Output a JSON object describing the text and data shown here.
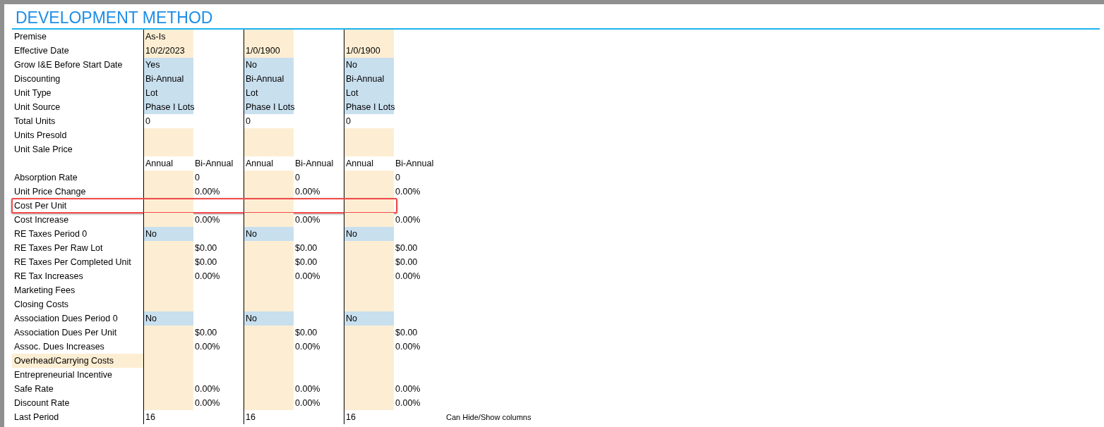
{
  "title": "DEVELOPMENT METHOD",
  "rows": [
    {
      "label": "Premise",
      "label_filled": false,
      "outlined": false,
      "cells": [
        {
          "kind": "input",
          "text": "As-Is"
        },
        {
          "kind": "plain"
        },
        {
          "kind": "input"
        },
        {
          "kind": "plain"
        },
        {
          "kind": "input"
        },
        {
          "kind": "plain"
        }
      ]
    },
    {
      "label": "Effective Date",
      "label_filled": false,
      "outlined": false,
      "cells": [
        {
          "kind": "input",
          "text": "10/2/2023"
        },
        {
          "kind": "plain"
        },
        {
          "kind": "input",
          "text": "1/0/1900"
        },
        {
          "kind": "plain"
        },
        {
          "kind": "input",
          "text": "1/0/1900"
        },
        {
          "kind": "plain"
        }
      ]
    },
    {
      "label": "Grow I&E Before Start Date",
      "label_filled": false,
      "outlined": false,
      "cells": [
        {
          "kind": "select",
          "text": "Yes"
        },
        {
          "kind": "plain"
        },
        {
          "kind": "select",
          "text": "No"
        },
        {
          "kind": "plain"
        },
        {
          "kind": "select",
          "text": "No"
        },
        {
          "kind": "plain"
        }
      ]
    },
    {
      "label": "Discounting",
      "label_filled": false,
      "outlined": false,
      "cells": [
        {
          "kind": "select",
          "text": "Bi-Annual"
        },
        {
          "kind": "plain"
        },
        {
          "kind": "select",
          "text": "Bi-Annual"
        },
        {
          "kind": "plain"
        },
        {
          "kind": "select",
          "text": "Bi-Annual"
        },
        {
          "kind": "plain"
        }
      ]
    },
    {
      "label": "Unit Type",
      "label_filled": false,
      "outlined": false,
      "cells": [
        {
          "kind": "select",
          "text": "Lot"
        },
        {
          "kind": "plain"
        },
        {
          "kind": "select",
          "text": "Lot"
        },
        {
          "kind": "plain"
        },
        {
          "kind": "select",
          "text": "Lot"
        },
        {
          "kind": "plain"
        }
      ]
    },
    {
      "label": "Unit Source",
      "label_filled": false,
      "outlined": false,
      "cells": [
        {
          "kind": "select",
          "text": "Phase I Lots"
        },
        {
          "kind": "plain"
        },
        {
          "kind": "select",
          "text": "Phase I Lots"
        },
        {
          "kind": "plain"
        },
        {
          "kind": "select",
          "text": "Phase I Lots"
        },
        {
          "kind": "plain"
        }
      ]
    },
    {
      "label": "Total Units",
      "label_filled": false,
      "outlined": false,
      "cells": [
        {
          "kind": "plain",
          "text": "0"
        },
        {
          "kind": "plain"
        },
        {
          "kind": "plain",
          "text": "0"
        },
        {
          "kind": "plain"
        },
        {
          "kind": "plain",
          "text": "0"
        },
        {
          "kind": "plain"
        }
      ]
    },
    {
      "label": "Units Presold",
      "label_filled": false,
      "outlined": false,
      "cells": [
        {
          "kind": "input"
        },
        {
          "kind": "plain"
        },
        {
          "kind": "input"
        },
        {
          "kind": "plain"
        },
        {
          "kind": "input"
        },
        {
          "kind": "plain"
        }
      ]
    },
    {
      "label": "Unit Sale Price",
      "label_filled": false,
      "outlined": false,
      "cells": [
        {
          "kind": "input"
        },
        {
          "kind": "plain"
        },
        {
          "kind": "input"
        },
        {
          "kind": "plain"
        },
        {
          "kind": "input"
        },
        {
          "kind": "plain"
        }
      ]
    },
    {
      "outlined": false,
      "cells": [
        {
          "kind": "plain",
          "text": "Annual"
        },
        {
          "kind": "plain",
          "text": "Bi-Annual"
        },
        {
          "kind": "plain",
          "text": "Annual"
        },
        {
          "kind": "plain",
          "text": "Bi-Annual"
        },
        {
          "kind": "plain",
          "text": "Annual"
        },
        {
          "kind": "plain",
          "text": "Bi-Annual"
        }
      ]
    },
    {
      "label": "Absorption Rate",
      "label_filled": false,
      "outlined": false,
      "cells": [
        {
          "kind": "input"
        },
        {
          "kind": "plain",
          "text": "0"
        },
        {
          "kind": "input"
        },
        {
          "kind": "plain",
          "text": "0"
        },
        {
          "kind": "input"
        },
        {
          "kind": "plain",
          "text": "0"
        }
      ]
    },
    {
      "label": "Unit Price Change",
      "label_filled": false,
      "outlined": false,
      "cells": [
        {
          "kind": "input"
        },
        {
          "kind": "plain",
          "text": "0.00%"
        },
        {
          "kind": "input"
        },
        {
          "kind": "plain",
          "text": "0.00%"
        },
        {
          "kind": "input"
        },
        {
          "kind": "plain",
          "text": "0.00%"
        }
      ]
    },
    {
      "label": "Cost Per Unit",
      "label_filled": false,
      "outlined": true,
      "cells": [
        {
          "kind": "input"
        },
        {
          "kind": "plain"
        },
        {
          "kind": "input"
        },
        {
          "kind": "plain"
        },
        {
          "kind": "input"
        },
        {
          "kind": "plain"
        }
      ]
    },
    {
      "label": "Cost Increase",
      "label_filled": false,
      "outlined": false,
      "cells": [
        {
          "kind": "input"
        },
        {
          "kind": "plain",
          "text": "0.00%"
        },
        {
          "kind": "input"
        },
        {
          "kind": "plain",
          "text": "0.00%"
        },
        {
          "kind": "input"
        },
        {
          "kind": "plain",
          "text": "0.00%"
        }
      ]
    },
    {
      "label": "RE Taxes Period 0",
      "label_filled": false,
      "outlined": false,
      "cells": [
        {
          "kind": "select",
          "text": "No"
        },
        {
          "kind": "plain"
        },
        {
          "kind": "select",
          "text": "No"
        },
        {
          "kind": "plain"
        },
        {
          "kind": "select",
          "text": "No"
        },
        {
          "kind": "plain"
        }
      ]
    },
    {
      "label": "RE Taxes Per Raw Lot",
      "label_filled": false,
      "outlined": false,
      "cells": [
        {
          "kind": "input"
        },
        {
          "kind": "plain",
          "text": "$0.00"
        },
        {
          "kind": "input"
        },
        {
          "kind": "plain",
          "text": "$0.00"
        },
        {
          "kind": "input"
        },
        {
          "kind": "plain",
          "text": "$0.00"
        }
      ]
    },
    {
      "label": "RE Taxes Per Completed Unit",
      "label_filled": false,
      "outlined": false,
      "cells": [
        {
          "kind": "input"
        },
        {
          "kind": "plain",
          "text": "$0.00"
        },
        {
          "kind": "input"
        },
        {
          "kind": "plain",
          "text": "$0.00"
        },
        {
          "kind": "input"
        },
        {
          "kind": "plain",
          "text": "$0.00"
        }
      ]
    },
    {
      "label": "RE Tax Increases",
      "label_filled": false,
      "outlined": false,
      "cells": [
        {
          "kind": "input"
        },
        {
          "kind": "plain",
          "text": "0.00%"
        },
        {
          "kind": "input"
        },
        {
          "kind": "plain",
          "text": "0.00%"
        },
        {
          "kind": "input"
        },
        {
          "kind": "plain",
          "text": "0.00%"
        }
      ]
    },
    {
      "label": "Marketing Fees",
      "label_filled": false,
      "outlined": false,
      "cells": [
        {
          "kind": "input"
        },
        {
          "kind": "plain"
        },
        {
          "kind": "input"
        },
        {
          "kind": "plain"
        },
        {
          "kind": "input"
        },
        {
          "kind": "plain"
        }
      ]
    },
    {
      "label": "Closing Costs",
      "label_filled": false,
      "outlined": false,
      "cells": [
        {
          "kind": "input"
        },
        {
          "kind": "plain"
        },
        {
          "kind": "input"
        },
        {
          "kind": "plain"
        },
        {
          "kind": "input"
        },
        {
          "kind": "plain"
        }
      ]
    },
    {
      "label": "Association Dues Period 0",
      "label_filled": false,
      "outlined": false,
      "cells": [
        {
          "kind": "select",
          "text": "No"
        },
        {
          "kind": "plain"
        },
        {
          "kind": "select",
          "text": "No"
        },
        {
          "kind": "plain"
        },
        {
          "kind": "select",
          "text": "No"
        },
        {
          "kind": "plain"
        }
      ]
    },
    {
      "label": "Association Dues Per Unit",
      "label_filled": false,
      "outlined": false,
      "cells": [
        {
          "kind": "input"
        },
        {
          "kind": "plain",
          "text": "$0.00"
        },
        {
          "kind": "input"
        },
        {
          "kind": "plain",
          "text": "$0.00"
        },
        {
          "kind": "input"
        },
        {
          "kind": "plain",
          "text": "$0.00"
        }
      ]
    },
    {
      "label": "Assoc. Dues Increases",
      "label_filled": false,
      "outlined": false,
      "cells": [
        {
          "kind": "input"
        },
        {
          "kind": "plain",
          "text": "0.00%"
        },
        {
          "kind": "input"
        },
        {
          "kind": "plain",
          "text": "0.00%"
        },
        {
          "kind": "input"
        },
        {
          "kind": "plain",
          "text": "0.00%"
        }
      ]
    },
    {
      "label": "Overhead/Carrying Costs",
      "label_filled": true,
      "outlined": false,
      "cells": [
        {
          "kind": "input"
        },
        {
          "kind": "plain"
        },
        {
          "kind": "input"
        },
        {
          "kind": "plain"
        },
        {
          "kind": "input"
        },
        {
          "kind": "plain"
        }
      ]
    },
    {
      "label": "Entrepreneurial Incentive",
      "label_filled": false,
      "outlined": false,
      "cells": [
        {
          "kind": "input"
        },
        {
          "kind": "plain"
        },
        {
          "kind": "input"
        },
        {
          "kind": "plain"
        },
        {
          "kind": "input"
        },
        {
          "kind": "plain"
        }
      ]
    },
    {
      "label": "Safe Rate",
      "label_filled": false,
      "outlined": false,
      "cells": [
        {
          "kind": "input"
        },
        {
          "kind": "plain",
          "text": "0.00%"
        },
        {
          "kind": "input"
        },
        {
          "kind": "plain",
          "text": "0.00%"
        },
        {
          "kind": "input"
        },
        {
          "kind": "plain",
          "text": "0.00%"
        }
      ]
    },
    {
      "label": "Discount Rate",
      "label_filled": false,
      "outlined": false,
      "cells": [
        {
          "kind": "input"
        },
        {
          "kind": "plain",
          "text": "0.00%"
        },
        {
          "kind": "input"
        },
        {
          "kind": "plain",
          "text": "0.00%"
        },
        {
          "kind": "input"
        },
        {
          "kind": "plain",
          "text": "0.00%"
        }
      ]
    },
    {
      "label": "Last Period",
      "label_filled": false,
      "outlined": false,
      "note": "Can Hide/Show columns",
      "cells": [
        {
          "kind": "plain",
          "text": "16"
        },
        {
          "kind": "plain"
        },
        {
          "kind": "plain",
          "text": "16"
        },
        {
          "kind": "plain"
        },
        {
          "kind": "plain",
          "text": "16"
        },
        {
          "kind": "plain"
        }
      ]
    }
  ]
}
